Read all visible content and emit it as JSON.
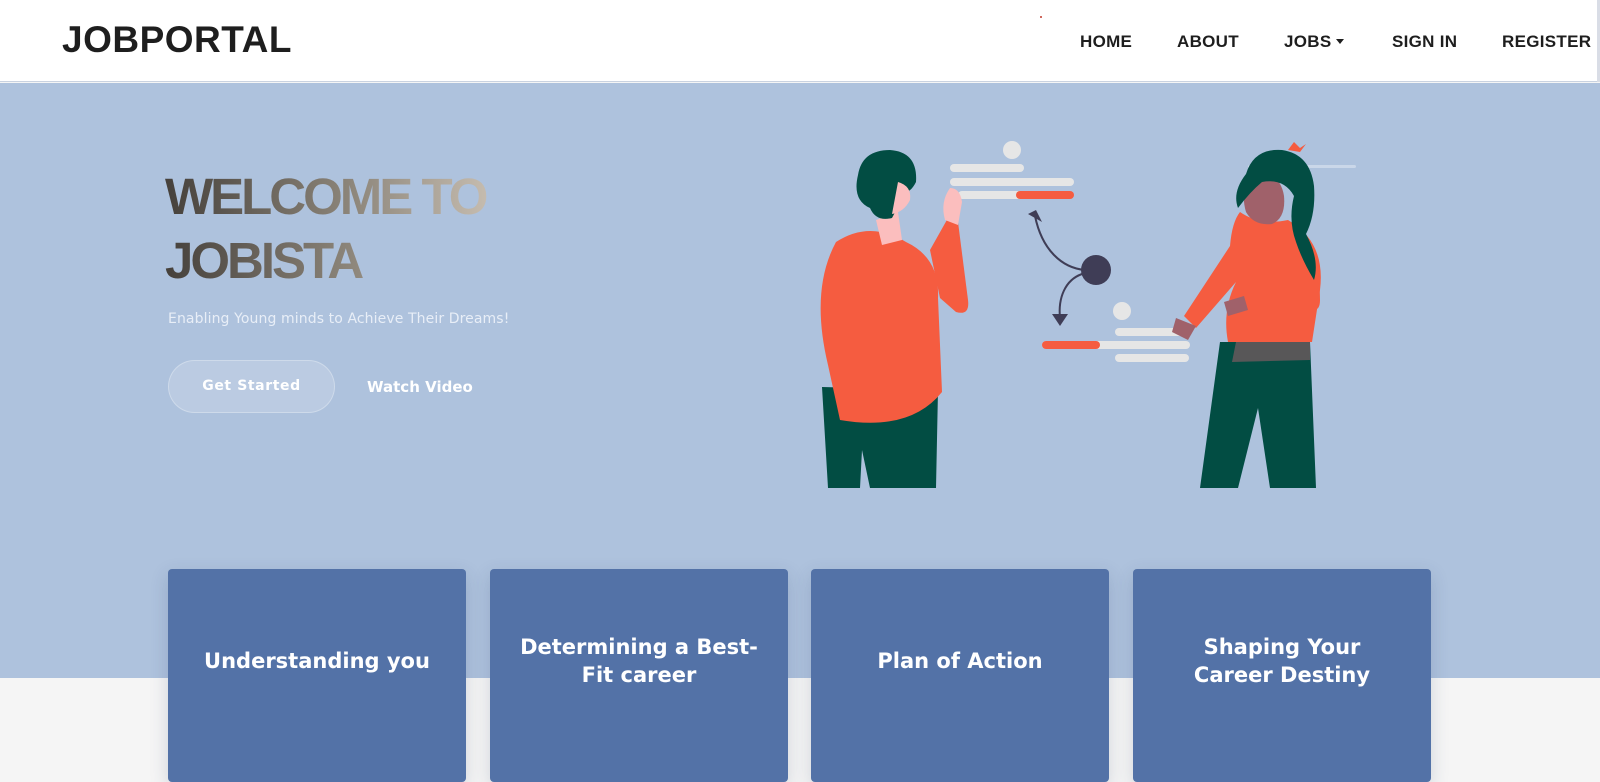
{
  "navbar": {
    "brand": "JOBPORTAL",
    "links": {
      "home": "HOME",
      "about": "ABOUT",
      "jobs": "JOBS",
      "signin": "SIGN IN",
      "register": "REGISTER"
    }
  },
  "hero": {
    "title_line1": "WELCOME TO",
    "title_line2": "JOBISTA",
    "tagline": "Enabling Young minds to Achieve Their Dreams!",
    "get_started": "Get Started",
    "watch_video": "Watch Video"
  },
  "cards": [
    {
      "title": "Understanding you"
    },
    {
      "title": "Determining a Best-Fit career"
    },
    {
      "title": "Plan of Action"
    },
    {
      "title": "Shaping Your Career Destiny"
    }
  ],
  "colors": {
    "hero_bg": "#aec2dd",
    "card_bg": "#5372a7",
    "accent_orange": "#f55c40",
    "figure_green": "#024d43"
  },
  "icons": {
    "jobs_dropdown": "caret-down-icon",
    "illustration": "people-collaborating-illustration"
  }
}
